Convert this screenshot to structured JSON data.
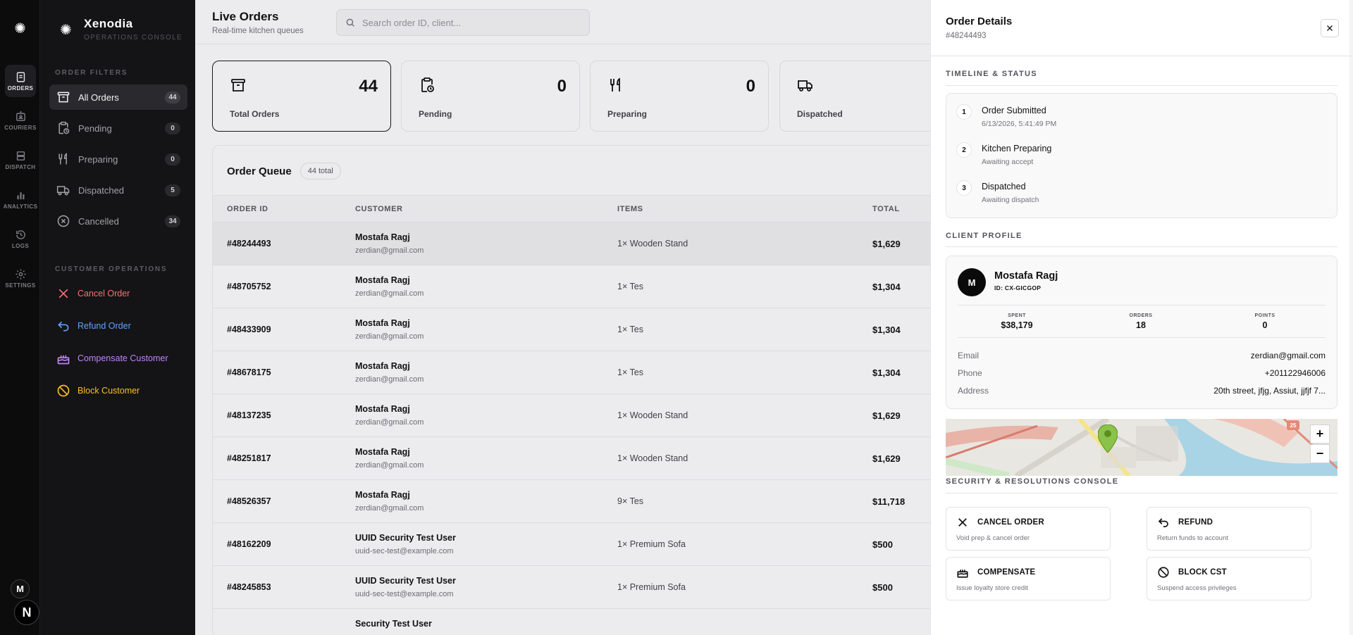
{
  "rail": {
    "items": [
      {
        "label": "ORDERS",
        "icon": "receipt-icon"
      },
      {
        "label": "COURIERS",
        "icon": "id-badge-icon"
      },
      {
        "label": "DISPATCH",
        "icon": "stack-icon"
      },
      {
        "label": "ANALYTICS",
        "icon": "bar-chart-icon"
      },
      {
        "label": "LOGS",
        "icon": "history-icon"
      },
      {
        "label": "SETTINGS",
        "icon": "gear-icon"
      }
    ],
    "avatar": "M",
    "badge": "N"
  },
  "brand": {
    "name": "Xenodia",
    "subtitle": "OPERATIONS CONSOLE"
  },
  "sidebar": {
    "filters_title": "ORDER FILTERS",
    "filters": [
      {
        "label": "All Orders",
        "count": "44"
      },
      {
        "label": "Pending",
        "count": "0"
      },
      {
        "label": "Preparing",
        "count": "0"
      },
      {
        "label": "Dispatched",
        "count": "5"
      },
      {
        "label": "Cancelled",
        "count": "34"
      }
    ],
    "ops_title": "CUSTOMER OPERATIONS",
    "ops": [
      {
        "label": "Cancel Order",
        "color": "#f87171"
      },
      {
        "label": "Refund Order",
        "color": "#60a5fa"
      },
      {
        "label": "Compensate Customer",
        "color": "#c084fc"
      },
      {
        "label": "Block Customer",
        "color": "#fbbf24"
      }
    ]
  },
  "header": {
    "title": "Live Orders",
    "subtitle": "Real-time kitchen queues",
    "search_placeholder": "Search order ID, client..."
  },
  "stats": [
    {
      "label": "Total Orders",
      "value": "44"
    },
    {
      "label": "Pending",
      "value": "0"
    },
    {
      "label": "Preparing",
      "value": "0"
    },
    {
      "label": "Dispatched",
      "value": ""
    }
  ],
  "queue": {
    "title": "Order Queue",
    "badge": "44 total",
    "columns": [
      "ORDER ID",
      "CUSTOMER",
      "ITEMS",
      "TOTAL"
    ],
    "rows": [
      {
        "id": "#48244493",
        "name": "Mostafa Ragj",
        "email": "zerdian@gmail.com",
        "items": "1× Wooden Stand",
        "total": "$1,629"
      },
      {
        "id": "#48705752",
        "name": "Mostafa Ragj",
        "email": "zerdian@gmail.com",
        "items": "1× Tes",
        "total": "$1,304"
      },
      {
        "id": "#48433909",
        "name": "Mostafa Ragj",
        "email": "zerdian@gmail.com",
        "items": "1× Tes",
        "total": "$1,304"
      },
      {
        "id": "#48678175",
        "name": "Mostafa Ragj",
        "email": "zerdian@gmail.com",
        "items": "1× Tes",
        "total": "$1,304"
      },
      {
        "id": "#48137235",
        "name": "Mostafa Ragj",
        "email": "zerdian@gmail.com",
        "items": "1× Wooden Stand",
        "total": "$1,629"
      },
      {
        "id": "#48251817",
        "name": "Mostafa Ragj",
        "email": "zerdian@gmail.com",
        "items": "1× Wooden Stand",
        "total": "$1,629"
      },
      {
        "id": "#48526357",
        "name": "Mostafa Ragj",
        "email": "zerdian@gmail.com",
        "items": "9× Tes",
        "total": "$11,718"
      },
      {
        "id": "#48162209",
        "name": "UUID Security Test User",
        "email": "uuid-sec-test@example.com",
        "items": "1× Premium Sofa",
        "total": "$500"
      },
      {
        "id": "#48245853",
        "name": "UUID Security Test User",
        "email": "uuid-sec-test@example.com",
        "items": "1× Premium Sofa",
        "total": "$500"
      },
      {
        "id": "",
        "name": "Security Test User",
        "email": "",
        "items": "",
        "total": ""
      }
    ]
  },
  "details": {
    "title": "Order Details",
    "order_id": "#48244493",
    "timeline_title": "TIMELINE & STATUS",
    "timeline": [
      {
        "num": "1",
        "title": "Order Submitted",
        "sub": "6/13/2026, 5:41:49 PM"
      },
      {
        "num": "2",
        "title": "Kitchen Preparing",
        "sub": "Awaiting accept"
      },
      {
        "num": "3",
        "title": "Dispatched",
        "sub": "Awaiting dispatch"
      }
    ],
    "profile_title": "CLIENT PROFILE",
    "profile": {
      "initial": "M",
      "name": "Mostafa Ragj",
      "id": "ID: CX-GICGOP",
      "stats": [
        {
          "k": "SPENT",
          "v": "$38,179"
        },
        {
          "k": "ORDERS",
          "v": "18"
        },
        {
          "k": "POINTS",
          "v": "0"
        }
      ],
      "fields": [
        {
          "k": "Email",
          "v": "zerdian@gmail.com"
        },
        {
          "k": "Phone",
          "v": "+201122946006"
        },
        {
          "k": "Address",
          "v": "20th street, jfjg, Assiut, jjfjf 7..."
        }
      ]
    },
    "map": {
      "zoom_in": "+",
      "zoom_out": "−",
      "road_badge": "25"
    },
    "console_title": "SECURITY & RESOLUTIONS CONSOLE",
    "actions": [
      {
        "title": "CANCEL ORDER",
        "desc": "Void prep & cancel order"
      },
      {
        "title": "REFUND",
        "desc": "Return funds to account"
      },
      {
        "title": "COMPENSATE",
        "desc": "Issue loyalty store credit"
      },
      {
        "title": "BLOCK CST",
        "desc": "Suspend access privileges"
      }
    ]
  }
}
